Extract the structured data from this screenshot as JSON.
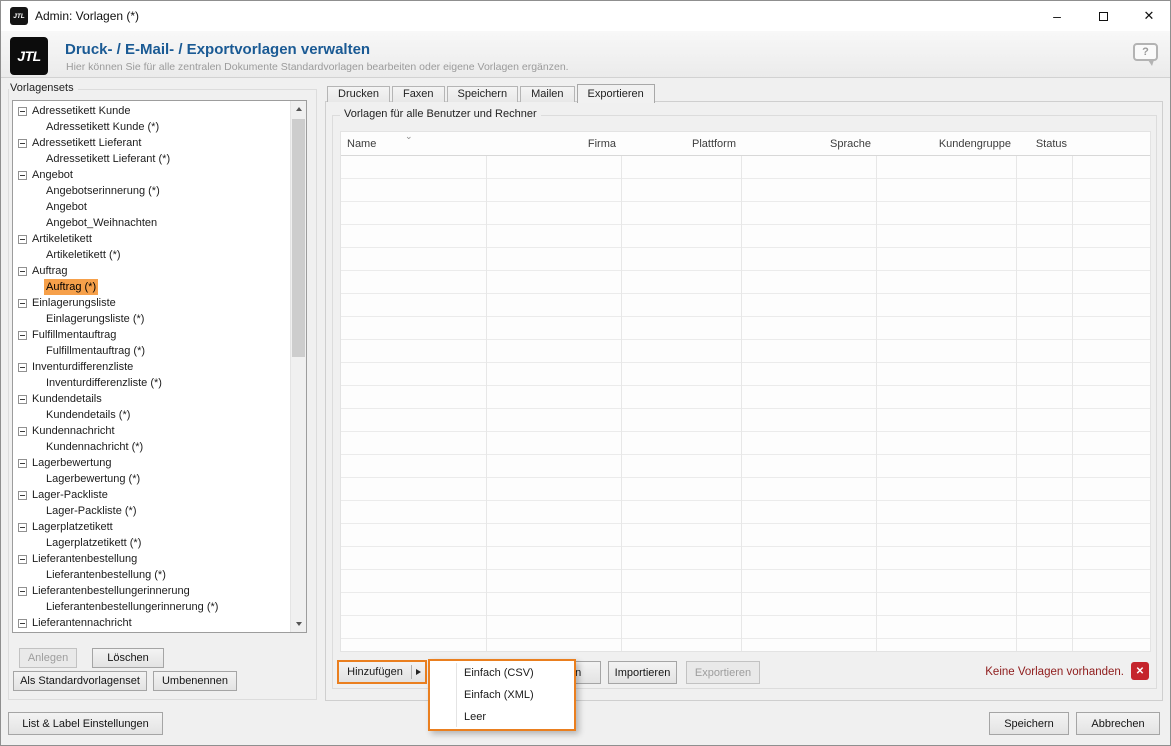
{
  "colors": {
    "accent_orange": "#EA7F1F",
    "selection_orange": "#F6A04A",
    "title_blue": "#1A5A94",
    "error_red": "#C5252C",
    "error_text_red": "#8E1B1B"
  },
  "titlebar": {
    "logo_text": "JTL",
    "title": "Admin: Vorlagen (*)",
    "minimize_glyph": "–",
    "close_glyph": "✕"
  },
  "header": {
    "logo_text": "JTL",
    "title": "Druck- / E-Mail- / Exportvorlagen verwalten",
    "subtitle": "Hier können Sie für alle zentralen Dokumente Standardvorlagen bearbeiten oder eigene Vorlagen ergänzen.",
    "help_glyph": "?"
  },
  "sidebar": {
    "group_label": "Vorlagensets",
    "tree": [
      {
        "label": "Adressetikett Kunde",
        "type": "parent"
      },
      {
        "label": "Adressetikett Kunde (*)",
        "type": "child"
      },
      {
        "label": "Adressetikett Lieferant",
        "type": "parent"
      },
      {
        "label": "Adressetikett Lieferant (*)",
        "type": "child"
      },
      {
        "label": "Angebot",
        "type": "parent"
      },
      {
        "label": "Angebotserinnerung (*)",
        "type": "child"
      },
      {
        "label": "Angebot",
        "type": "child"
      },
      {
        "label": "Angebot_Weihnachten",
        "type": "child"
      },
      {
        "label": "Artikeletikett",
        "type": "parent"
      },
      {
        "label": "Artikeletikett (*)",
        "type": "child"
      },
      {
        "label": "Auftrag",
        "type": "parent"
      },
      {
        "label": "Auftrag (*)",
        "type": "child",
        "selected": true
      },
      {
        "label": "Einlagerungsliste",
        "type": "parent"
      },
      {
        "label": "Einlagerungsliste (*)",
        "type": "child"
      },
      {
        "label": "Fulfillmentauftrag",
        "type": "parent"
      },
      {
        "label": "Fulfillmentauftrag (*)",
        "type": "child"
      },
      {
        "label": "Inventurdifferenzliste",
        "type": "parent"
      },
      {
        "label": "Inventurdifferenzliste (*)",
        "type": "child"
      },
      {
        "label": "Kundendetails",
        "type": "parent"
      },
      {
        "label": "Kundendetails (*)",
        "type": "child"
      },
      {
        "label": "Kundennachricht",
        "type": "parent"
      },
      {
        "label": "Kundennachricht (*)",
        "type": "child"
      },
      {
        "label": "Lagerbewertung",
        "type": "parent"
      },
      {
        "label": "Lagerbewertung (*)",
        "type": "child"
      },
      {
        "label": "Lager-Packliste",
        "type": "parent"
      },
      {
        "label": "Lager-Packliste (*)",
        "type": "child"
      },
      {
        "label": "Lagerplatzetikett",
        "type": "parent"
      },
      {
        "label": "Lagerplatzetikett (*)",
        "type": "child"
      },
      {
        "label": "Lieferantenbestellung",
        "type": "parent"
      },
      {
        "label": "Lieferantenbestellung (*)",
        "type": "child"
      },
      {
        "label": "Lieferantenbestellungerinnerung",
        "type": "parent"
      },
      {
        "label": "Lieferantenbestellungerinnerung (*)",
        "type": "child"
      },
      {
        "label": "Lieferantennachricht",
        "type": "parent"
      }
    ],
    "buttons": {
      "anlegen": "Anlegen",
      "loeschen": "Löschen",
      "als_standard": "Als Standardvorlagenset",
      "umbenennen": "Umbenennen",
      "list_label": "List & Label Einstellungen"
    }
  },
  "tabs": {
    "items": [
      "Drucken",
      "Faxen",
      "Speichern",
      "Mailen",
      "Exportieren"
    ],
    "active": "Exportieren"
  },
  "content": {
    "group_label": "Vorlagen für alle Benutzer und Rechner",
    "table": {
      "columns": [
        "Name",
        "Firma",
        "Plattform",
        "Sprache",
        "Kundengruppe",
        "Status"
      ],
      "sort_glyph": "⌄",
      "rows": []
    },
    "actions": {
      "hinzufuegen": "Hinzufügen",
      "loeschen": "Löschen",
      "importieren": "Importieren",
      "exportieren": "Exportieren"
    },
    "status_message": "Keine Vorlagen vorhanden.",
    "error_icon_glyph": "✕"
  },
  "menu": {
    "items": [
      "Einfach (CSV)",
      "Einfach (XML)",
      "Leer"
    ]
  },
  "footer": {
    "speichern": "Speichern",
    "abbrechen": "Abbrechen"
  }
}
